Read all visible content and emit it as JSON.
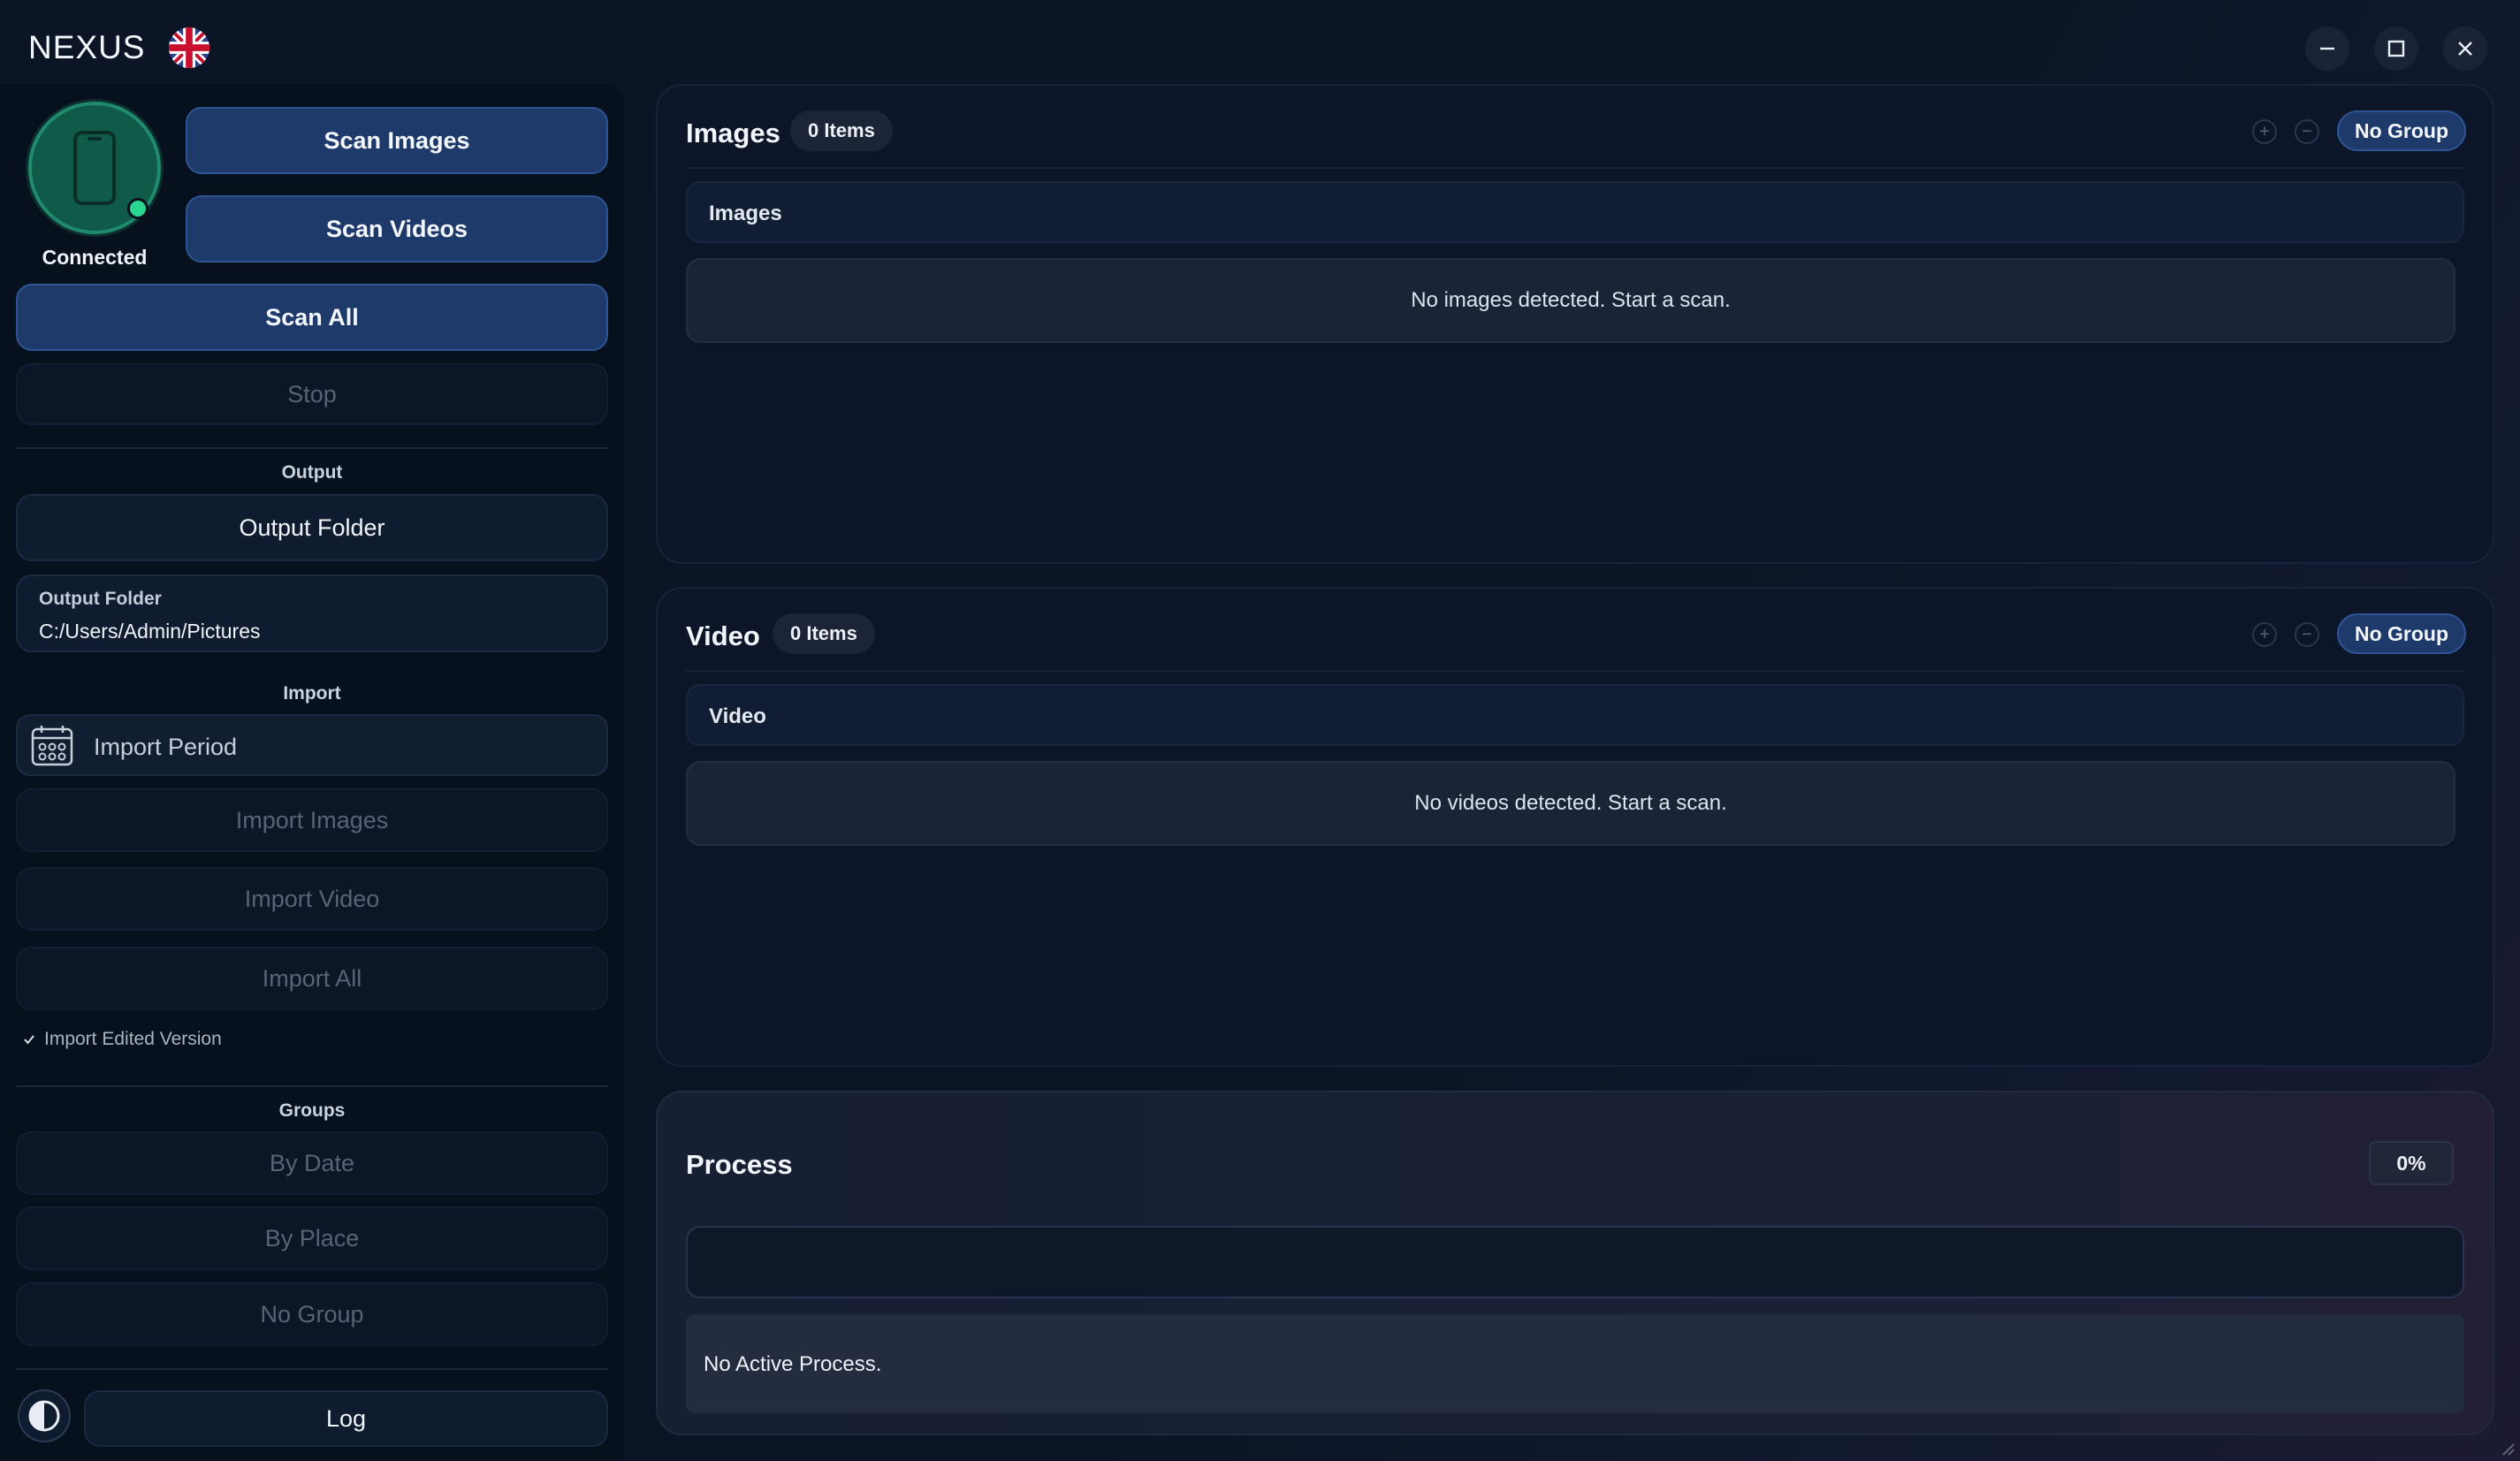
{
  "app": {
    "title": "NEXUS"
  },
  "device": {
    "status": "Connected"
  },
  "scan": {
    "images_label": "Scan Images",
    "videos_label": "Scan Videos",
    "all_label": "Scan All",
    "stop_label": "Stop"
  },
  "output": {
    "section_label": "Output",
    "button_label": "Output Folder",
    "field_label": "Output Folder",
    "field_value": "C:/Users/Admin/Pictures"
  },
  "import": {
    "section_label": "Import",
    "period_label": "Import Period",
    "images_label": "Import Images",
    "video_label": "Import Video",
    "all_label": "Import All",
    "edited_checkbox_label": "Import Edited Version",
    "edited_checked": true
  },
  "groups": {
    "section_label": "Groups",
    "by_date": "By Date",
    "by_place": "By Place",
    "no_group": "No Group"
  },
  "footer": {
    "log_label": "Log"
  },
  "images_panel": {
    "title": "Images",
    "count": "0 Items",
    "group_label": "No Group",
    "header": "Images",
    "empty_message": "No images detected. Start a scan."
  },
  "video_panel": {
    "title": "Video",
    "count": "0 Items",
    "group_label": "No Group",
    "header": "Video",
    "empty_message": "No videos detected. Start a scan."
  },
  "process": {
    "title": "Process",
    "percent": "0%",
    "progress": 0,
    "message": "No Active Process."
  },
  "colors": {
    "accent": "#1e3a6a",
    "connected": "#2bd48f",
    "background": "#0b1424"
  },
  "icons": {
    "flag": "uk-flag-icon",
    "device": "phone-icon",
    "calendar": "calendar-icon",
    "theme": "contrast-icon"
  }
}
